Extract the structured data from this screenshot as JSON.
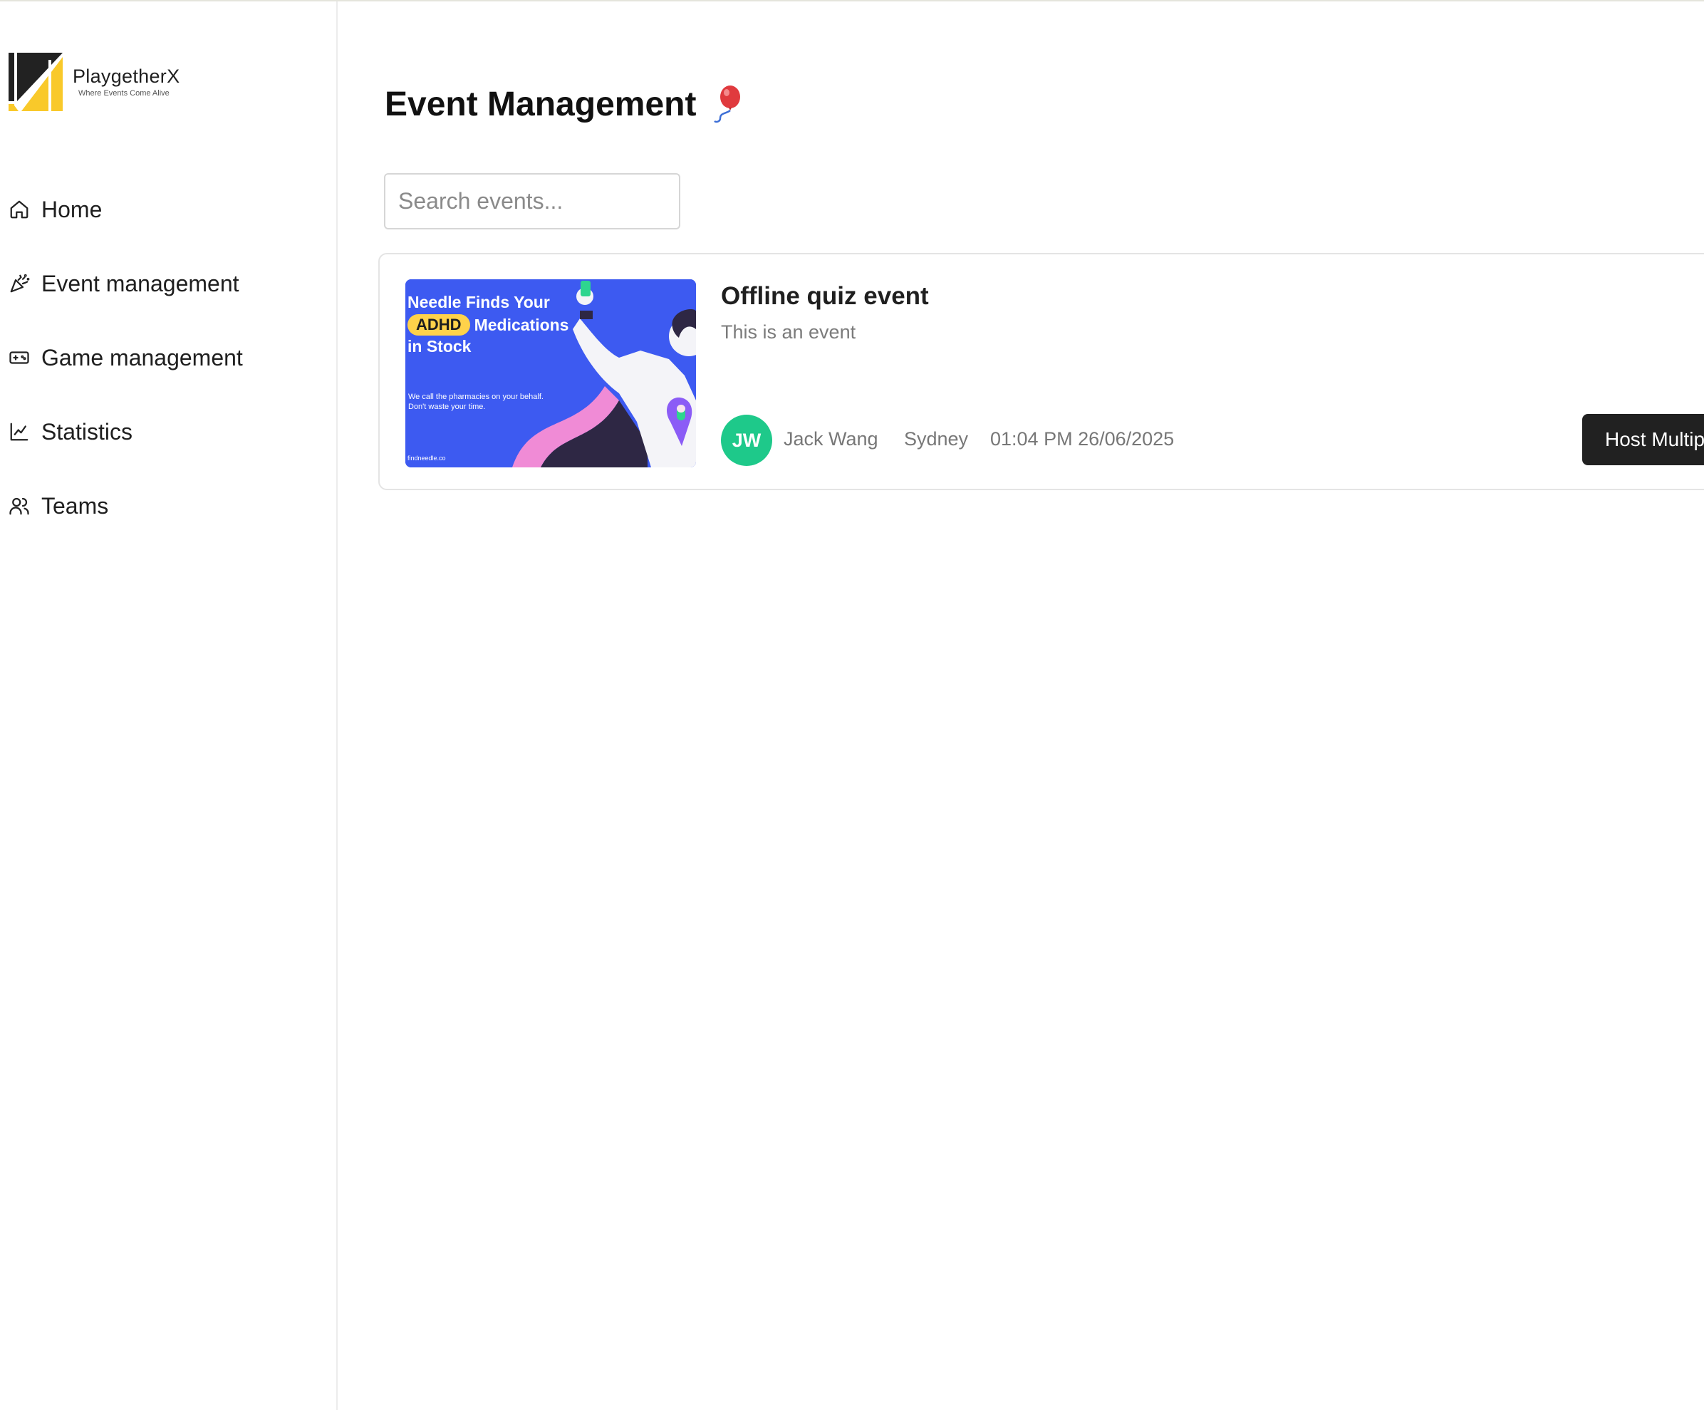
{
  "app": {
    "name": "PlaygetherX",
    "tagline": "Where Events Come Alive"
  },
  "sidebar": {
    "items": [
      {
        "label": "Home",
        "icon": "home-icon"
      },
      {
        "label": "Event management",
        "icon": "party-popper-icon",
        "active": true
      },
      {
        "label": "Game management",
        "icon": "gamepad-icon"
      },
      {
        "label": "Statistics",
        "icon": "line-chart-icon"
      },
      {
        "label": "Teams",
        "icon": "users-icon"
      }
    ]
  },
  "page": {
    "title": "Event Management",
    "title_emoji": "balloon-icon"
  },
  "search": {
    "placeholder": "Search events...",
    "value": ""
  },
  "events": [
    {
      "title": "Offline quiz event",
      "description": "This is an event",
      "host_initials": "JW",
      "host_name": "Jack Wang",
      "location": "Sydney",
      "datetime": "01:04 PM 26/06/2025",
      "action_label": "Host Multip",
      "thumbnail": {
        "line1": "Needle Finds Your",
        "badge": "ADHD",
        "line2": "Medications",
        "line3": "in Stock",
        "small_line1": "We call the pharmacies on your behalf.",
        "small_line2": "Don't waste your time.",
        "url": "findneedle.co"
      }
    }
  ],
  "colors": {
    "accent_yellow": "#f9c92a",
    "avatar_green": "#1ec98a",
    "thumb_blue": "#3d5af1",
    "button_dark": "#212121"
  }
}
